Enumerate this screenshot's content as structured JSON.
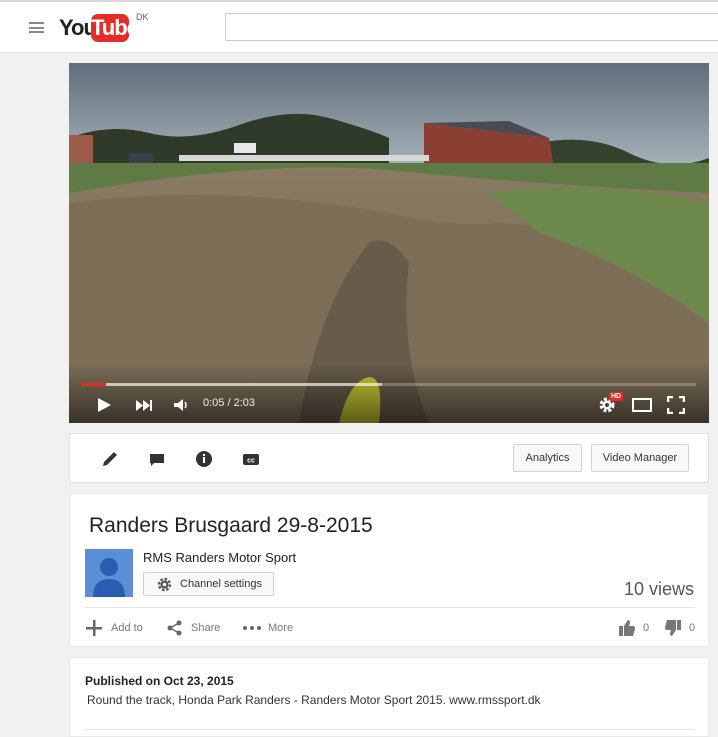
{
  "header": {
    "logo_you": "You",
    "logo_tube": "Tube",
    "country_code": "DK",
    "search_value": ""
  },
  "player": {
    "current_time": "0:05",
    "separator": "/",
    "duration": "2:03",
    "time_display": "0:05 / 2:03",
    "played_fraction": 0.04,
    "buffered_fraction": 0.49,
    "hd_badge": "HD"
  },
  "creator_toolbar": {
    "analytics_label": "Analytics",
    "video_manager_label": "Video Manager",
    "icons": [
      "edit-icon",
      "annotations-icon",
      "info-icon",
      "captions-icon"
    ]
  },
  "video_info": {
    "title": "Randers Brusgaard 29-8-2015",
    "channel_name": "RMS Randers Motor Sport",
    "channel_settings_label": "Channel settings",
    "views": "10 views",
    "add_to_label": "Add to",
    "share_label": "Share",
    "more_label": "More",
    "likes": "0",
    "dislikes": "0"
  },
  "description": {
    "published": "Published on Oct 23, 2015",
    "text": "Round the track, Honda Park Randers - Randers Motor Sport 2015. www.rmssport.dk"
  },
  "colors": {
    "brand_red": "#e52d27",
    "avatar_blue": "#5a8fd8",
    "page_bg": "#f1f1f1"
  }
}
